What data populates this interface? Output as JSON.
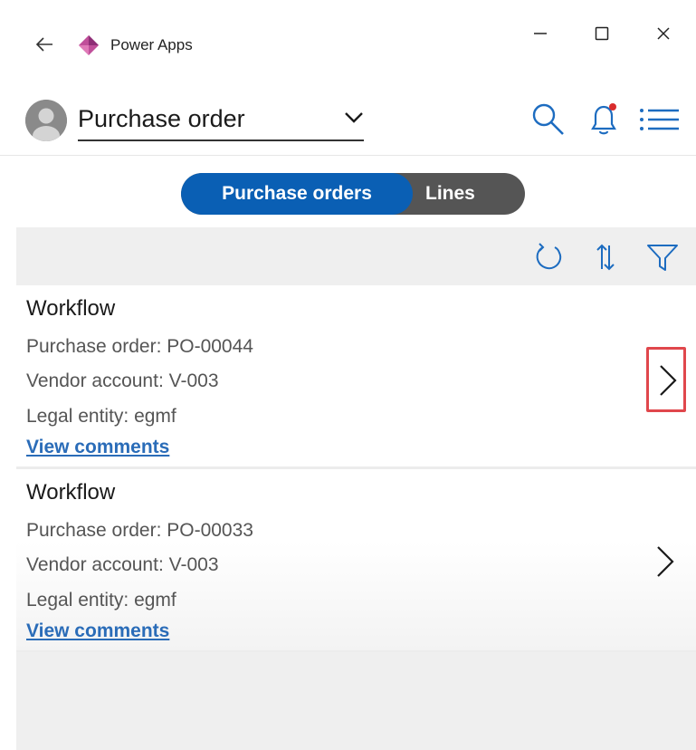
{
  "window": {
    "app_title": "Power Apps",
    "icons": {
      "back": "arrow-left-icon",
      "logo": "power-apps-logo",
      "minimize": "minimize-icon",
      "maximize": "maximize-icon",
      "close": "close-icon"
    },
    "logo_color": "#b4458e"
  },
  "header": {
    "entity": "Purchase order",
    "icons": [
      "search-icon",
      "bell-icon",
      "list-menu-icon"
    ],
    "accent": "#0a5fb4",
    "notification_dot_color": "#d92c2c"
  },
  "toggle": {
    "options": [
      "Purchase orders",
      "Lines"
    ],
    "selected": "Purchase orders"
  },
  "toolbar": {
    "icons": [
      "refresh-icon",
      "sort-icon",
      "filter-icon"
    ]
  },
  "records": [
    {
      "title": "Workflow",
      "purchase_order": "Purchase order: PO-00044",
      "vendor_account": "Vendor account: V-003",
      "legal_entity": "Legal entity: egmf",
      "link": "View comments"
    },
    {
      "title": "Workflow",
      "purchase_order": "Purchase order: PO-00033",
      "vendor_account": "Vendor account: V-003",
      "legal_entity": "Legal entity: egmf",
      "link": "View comments"
    }
  ]
}
